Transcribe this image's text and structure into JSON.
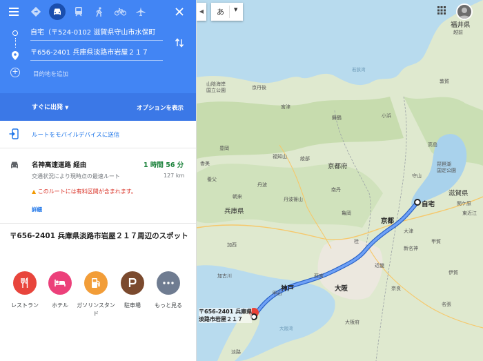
{
  "directions": {
    "modes": [
      "menu-icon",
      "best-route-icon",
      "car-icon",
      "transit-icon",
      "walk-icon",
      "bicycle-icon",
      "flight-icon",
      "close-icon"
    ],
    "origin": "自宅（〒524-0102 滋賀県守山市水保町",
    "destination": "〒656-2401 兵庫県淡路市岩屋２１７",
    "add_destination": "目的地を追加",
    "depart_now": "すぐに出発",
    "options": "オプションを表示",
    "send_to_device": "ルートをモバイルデバイスに送信"
  },
  "route": {
    "via": "名神高速道路 経由",
    "time": "1 時間 56 分",
    "desc": "交通状況により現時点の最速ルート",
    "distance": "127 km",
    "toll_warning": "このルートには有料区間が含まれます。",
    "details": "詳細"
  },
  "spots": {
    "title": "〒656-2401 兵庫県淡路市岩屋２１７周辺のスポット",
    "items": [
      {
        "label": "レストラン",
        "icon": "restaurant-icon",
        "color": "#e8453c"
      },
      {
        "label": "ホテル",
        "icon": "hotel-icon",
        "color": "#ec407a"
      },
      {
        "label": "ガソリンスタンド",
        "icon": "gas-station-icon",
        "color": "#f29d38"
      },
      {
        "label": "駐車場",
        "icon": "parking-icon",
        "color": "#7b4a2e"
      },
      {
        "label": "もっと見る",
        "icon": "more-icon",
        "color": "#6f7c91"
      }
    ]
  },
  "map": {
    "ime_char": "あ",
    "origin_label": "自宅",
    "destination_label": "〒656-2401 兵庫県\n淡路市岩屋２１７",
    "labels": {
      "fukui": "福井県",
      "shiga": "滋賀県",
      "kyoto_pref": "京都府",
      "hyogo": "兵庫県",
      "kyoto": "京都",
      "osaka": "大阪",
      "kobe": "神戸",
      "osaka_pref": "大阪府",
      "sanin_park": "山陰海岸\n国立公園",
      "kyotango": "京丹後",
      "miyazu": "宮津",
      "maizuru": "舞鶴",
      "obama": "小浜",
      "tsuruga": "敦賀",
      "takashima": "高島",
      "fukuchiyama": "福知山",
      "ayabe": "綾部",
      "nantan": "南丹",
      "kameoka": "亀岡",
      "tanba": "丹波",
      "tanbasasayama": "丹波篠山",
      "toyooka": "豊岡",
      "kami": "香美",
      "yabu": "養父",
      "asago": "朝来",
      "kasai": "加西",
      "kakogawa": "加古川",
      "akashi": "明石",
      "nishinomiya": "西宮",
      "nara": "奈良",
      "iga": "伊賀",
      "nabari": "名張",
      "koka": "甲賀",
      "higashiomi": "東近江",
      "otsu": "大津",
      "moriyama": "守山",
      "biwako_park": "琵琶湖\n国定公園",
      "sekigahara": "関ケ原",
      "echizen": "越前",
      "kinki": "近畿",
      "shindaisen": "新名神",
      "katsura": "桂",
      "wakasa": "若狭湾",
      "kanmon": "大阪湾",
      "awaji": "淡路"
    }
  },
  "colors": {
    "header_blue": "#4285f4",
    "route_blue": "#4a8af4",
    "route_outline": "#2a63c6",
    "dest_red": "#ea4335"
  }
}
